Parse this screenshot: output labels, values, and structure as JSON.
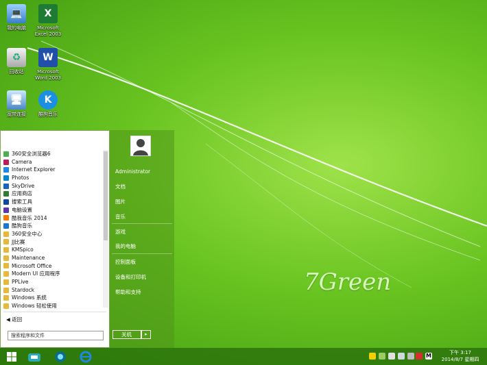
{
  "brand": "7Green",
  "desktop_icons": [
    {
      "label": "我的电脑",
      "icon": "computer-icon"
    },
    {
      "label": "Microsoft Excel 2003",
      "icon": "excel-icon"
    },
    {
      "label": "回收站",
      "icon": "recycle-bin-icon"
    },
    {
      "label": "Microsoft Word 2003",
      "icon": "word-icon"
    },
    {
      "label": "宽带连接",
      "icon": "network-icon"
    },
    {
      "label": "酷狗音乐",
      "icon": "kugou-icon"
    },
    {
      "label": "",
      "icon": "qq-icon"
    },
    {
      "label": "",
      "icon": "iqiyi-icon"
    }
  ],
  "start_menu": {
    "programs": [
      {
        "label": "360安全浏览器6",
        "icon": "browser-360-icon",
        "color": "#4caf50"
      },
      {
        "label": "Camera",
        "icon": "camera-icon",
        "color": "#c2185b"
      },
      {
        "label": "Internet Explorer",
        "icon": "ie-icon",
        "color": "#1e88e5"
      },
      {
        "label": "Photos",
        "icon": "photos-icon",
        "color": "#0288d1"
      },
      {
        "label": "SkyDrive",
        "icon": "skydrive-icon",
        "color": "#1565c0"
      },
      {
        "label": "应用商店",
        "icon": "store-icon",
        "color": "#2e7d32"
      },
      {
        "label": "搜索工具",
        "icon": "search-tool-icon",
        "color": "#0d47a1"
      },
      {
        "label": "电脑设置",
        "icon": "settings-icon",
        "color": "#5e35b1"
      },
      {
        "label": "酷我音乐 2014",
        "icon": "kuwo-icon",
        "color": "#f57c00"
      },
      {
        "label": "酷狗音乐",
        "icon": "kugou-icon",
        "color": "#1976d2"
      },
      {
        "label": "360安全中心",
        "icon": "folder-icon",
        "color": "#e8b83a"
      },
      {
        "label": "JJ比赛",
        "icon": "folder-icon",
        "color": "#e8b83a"
      },
      {
        "label": "KMSpico",
        "icon": "folder-icon",
        "color": "#e8b83a"
      },
      {
        "label": "Maintenance",
        "icon": "folder-icon",
        "color": "#e8b83a"
      },
      {
        "label": "Microsoft Office",
        "icon": "folder-icon",
        "color": "#e8b83a"
      },
      {
        "label": "Modern UI 应用程序",
        "icon": "folder-icon",
        "color": "#e8b83a"
      },
      {
        "label": "PPLive",
        "icon": "folder-icon",
        "color": "#e8b83a"
      },
      {
        "label": "Stardock",
        "icon": "folder-icon",
        "color": "#e8b83a"
      },
      {
        "label": "Windows 系统",
        "icon": "folder-icon",
        "color": "#e8b83a"
      },
      {
        "label": "Windows 轻松使用",
        "icon": "folder-icon",
        "color": "#e8b83a"
      }
    ],
    "back_label": "返回",
    "search_placeholder": "搜索程序和文件",
    "user_name": "Administrator",
    "right_items": [
      "文档",
      "图片",
      "音乐",
      "游戏",
      "我的电脑",
      "控制面板",
      "设备和打印机",
      "帮助和支持"
    ],
    "shutdown_label": "关机"
  },
  "taskbar": {
    "apps": [
      "start-icon",
      "store-icon",
      "media-icon",
      "ie-icon"
    ],
    "clock_time": "下午 3:17",
    "clock_date": "2014/8/7 星期四"
  },
  "colors": {
    "accent": "#5a9e1e",
    "taskbar": "#2c6e0a"
  }
}
